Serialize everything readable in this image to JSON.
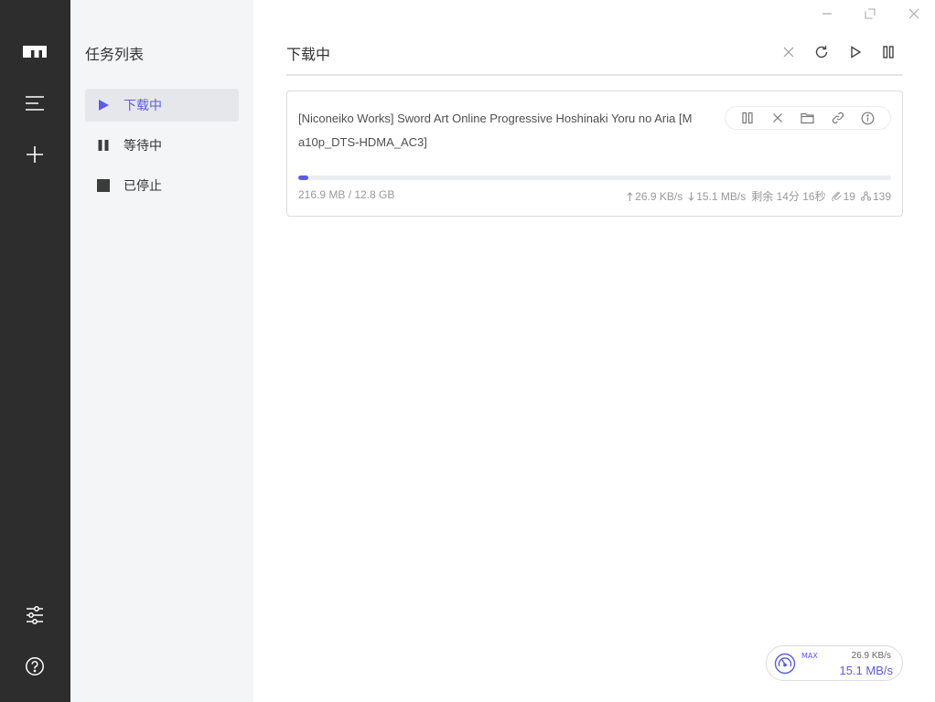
{
  "rail": {
    "items": [
      {
        "name": "logo-icon"
      },
      {
        "name": "menu-icon"
      },
      {
        "name": "plus-icon"
      },
      {
        "name": "sliders-icon"
      },
      {
        "name": "help-circle-icon"
      }
    ]
  },
  "sidebar": {
    "title": "任务列表",
    "items": [
      {
        "label": "下载中",
        "icon": "play-icon",
        "active": true
      },
      {
        "label": "等待中",
        "icon": "pause-icon",
        "active": false
      },
      {
        "label": "已停止",
        "icon": "stop-icon",
        "active": false
      }
    ]
  },
  "header": {
    "title": "下载中",
    "actions": [
      "close-icon",
      "refresh-icon",
      "play-icon",
      "pause-icon"
    ]
  },
  "task": {
    "name": "[Niconeiko Works] Sword Art Online Progressive Hoshinaki Yoru no Aria [Ma10p_DTS-HDMA_AC3]",
    "size": "216.9 MB / 12.8 GB",
    "progress": 0.017,
    "upload_speed": "26.9 KB/s",
    "download_speed": "15.1 MB/s",
    "remaining": "剩余 14分 16秒",
    "seeders": "19",
    "connections": "139",
    "actions": [
      "pause-icon",
      "close-icon",
      "folder-icon",
      "link-icon",
      "info-icon"
    ]
  },
  "speedometer": {
    "max_label": "MAX",
    "upload": "26.9 KB/s",
    "download": "15.1 MB/s"
  },
  "colors": {
    "accent": "#5b5bea",
    "rail_bg": "#2d2d2d",
    "sidebar_bg": "#f4f5f7"
  }
}
